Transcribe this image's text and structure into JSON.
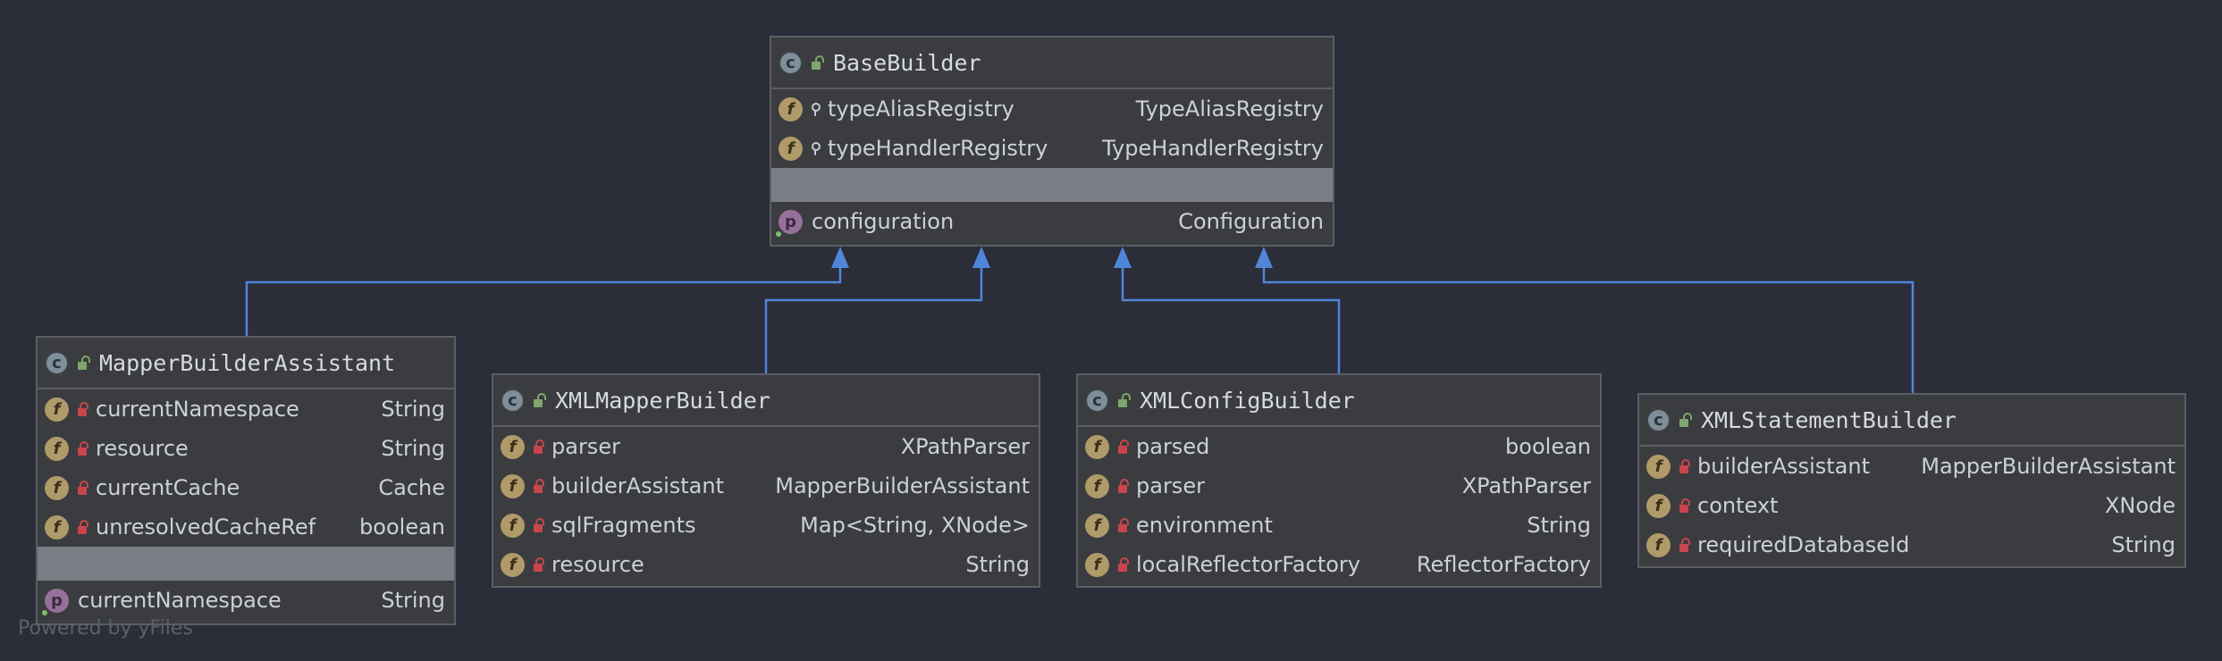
{
  "diagram": {
    "colors": {
      "background": "#2b2d38",
      "edge": "#4f86d9",
      "node_fill": "#3a3c40",
      "node_border": "#5b5e63"
    },
    "nodes": {
      "base": {
        "title": "BaseBuilder",
        "fields": [
          {
            "name": "typeAliasRegistry",
            "type": "TypeAliasRegistry"
          },
          {
            "name": "typeHandlerRegistry",
            "type": "TypeHandlerRegistry"
          }
        ],
        "properties": [
          {
            "name": "configuration",
            "type": "Configuration"
          }
        ]
      },
      "mapper_assistant": {
        "title": "MapperBuilderAssistant",
        "fields": [
          {
            "name": "currentNamespace",
            "type": "String"
          },
          {
            "name": "resource",
            "type": "String"
          },
          {
            "name": "currentCache",
            "type": "Cache"
          },
          {
            "name": "unresolvedCacheRef",
            "type": "boolean"
          }
        ],
        "properties": [
          {
            "name": "currentNamespace",
            "type": "String"
          }
        ]
      },
      "xml_mapper": {
        "title": "XMLMapperBuilder",
        "fields": [
          {
            "name": "parser",
            "type": "XPathParser"
          },
          {
            "name": "builderAssistant",
            "type": "MapperBuilderAssistant"
          },
          {
            "name": "sqlFragments",
            "type": "Map<String, XNode>"
          },
          {
            "name": "resource",
            "type": "String"
          }
        ]
      },
      "xml_config": {
        "title": "XMLConfigBuilder",
        "fields": [
          {
            "name": "parsed",
            "type": "boolean"
          },
          {
            "name": "parser",
            "type": "XPathParser"
          },
          {
            "name": "environment",
            "type": "String"
          },
          {
            "name": "localReflectorFactory",
            "type": "ReflectorFactory"
          }
        ]
      },
      "xml_statement": {
        "title": "XMLStatementBuilder",
        "fields": [
          {
            "name": "builderAssistant",
            "type": "MapperBuilderAssistant"
          },
          {
            "name": "context",
            "type": "XNode"
          },
          {
            "name": "requiredDatabaseId",
            "type": "String"
          }
        ]
      }
    },
    "edges": [
      {
        "from": "mapper_assistant",
        "to": "base",
        "kind": "extends"
      },
      {
        "from": "xml_mapper",
        "to": "base",
        "kind": "extends"
      },
      {
        "from": "xml_config",
        "to": "base",
        "kind": "extends"
      },
      {
        "from": "xml_statement",
        "to": "base",
        "kind": "extends"
      }
    ],
    "watermark": "Powered by yFiles"
  }
}
